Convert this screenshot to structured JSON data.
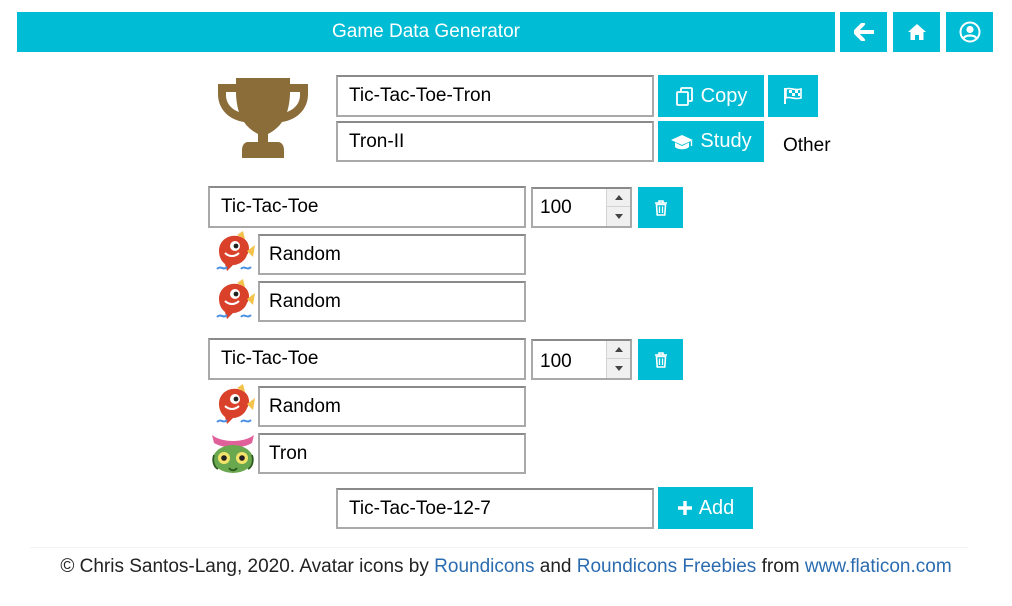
{
  "header": {
    "title": "Game Data Generator",
    "back_icon": "arrow-left-icon",
    "home_icon": "home-icon",
    "profile_icon": "user-circle-icon",
    "accent": "#00bcd4"
  },
  "top": {
    "trophy_icon": "trophy-icon",
    "trophy_color": "#8b6d3a",
    "name_value": "Tic-Tac-Toe-Tron",
    "sub_value": "Tron-II",
    "copy_label": "Copy",
    "copy_icon": "copy-icon",
    "flag_icon": "flag-checkered-icon",
    "study_label": "Study",
    "study_icon": "graduation-cap-icon",
    "other_label": "Other"
  },
  "matches": [
    {
      "game": "Tic-Tac-Toe",
      "count": "100",
      "delete_icon": "trash-icon",
      "players": [
        {
          "name": "Random",
          "avatar": "fish-avatar-icon"
        },
        {
          "name": "Random",
          "avatar": "fish-avatar-icon"
        }
      ]
    },
    {
      "game": "Tic-Tac-Toe",
      "count": "100",
      "delete_icon": "trash-icon",
      "players": [
        {
          "name": "Random",
          "avatar": "fish-avatar-icon"
        },
        {
          "name": "Tron",
          "avatar": "bug-avatar-icon"
        }
      ]
    }
  ],
  "add": {
    "value": "Tic-Tac-Toe-12-7",
    "label": "Add",
    "icon": "plus-icon"
  },
  "footer": {
    "prefix": "© Chris Santos-Lang, 2020. Avatar icons by",
    "link1": "Roundicons",
    "and": "and",
    "link2": "Roundicons Freebies",
    "from": "from",
    "link3": "www.flaticon.com"
  }
}
